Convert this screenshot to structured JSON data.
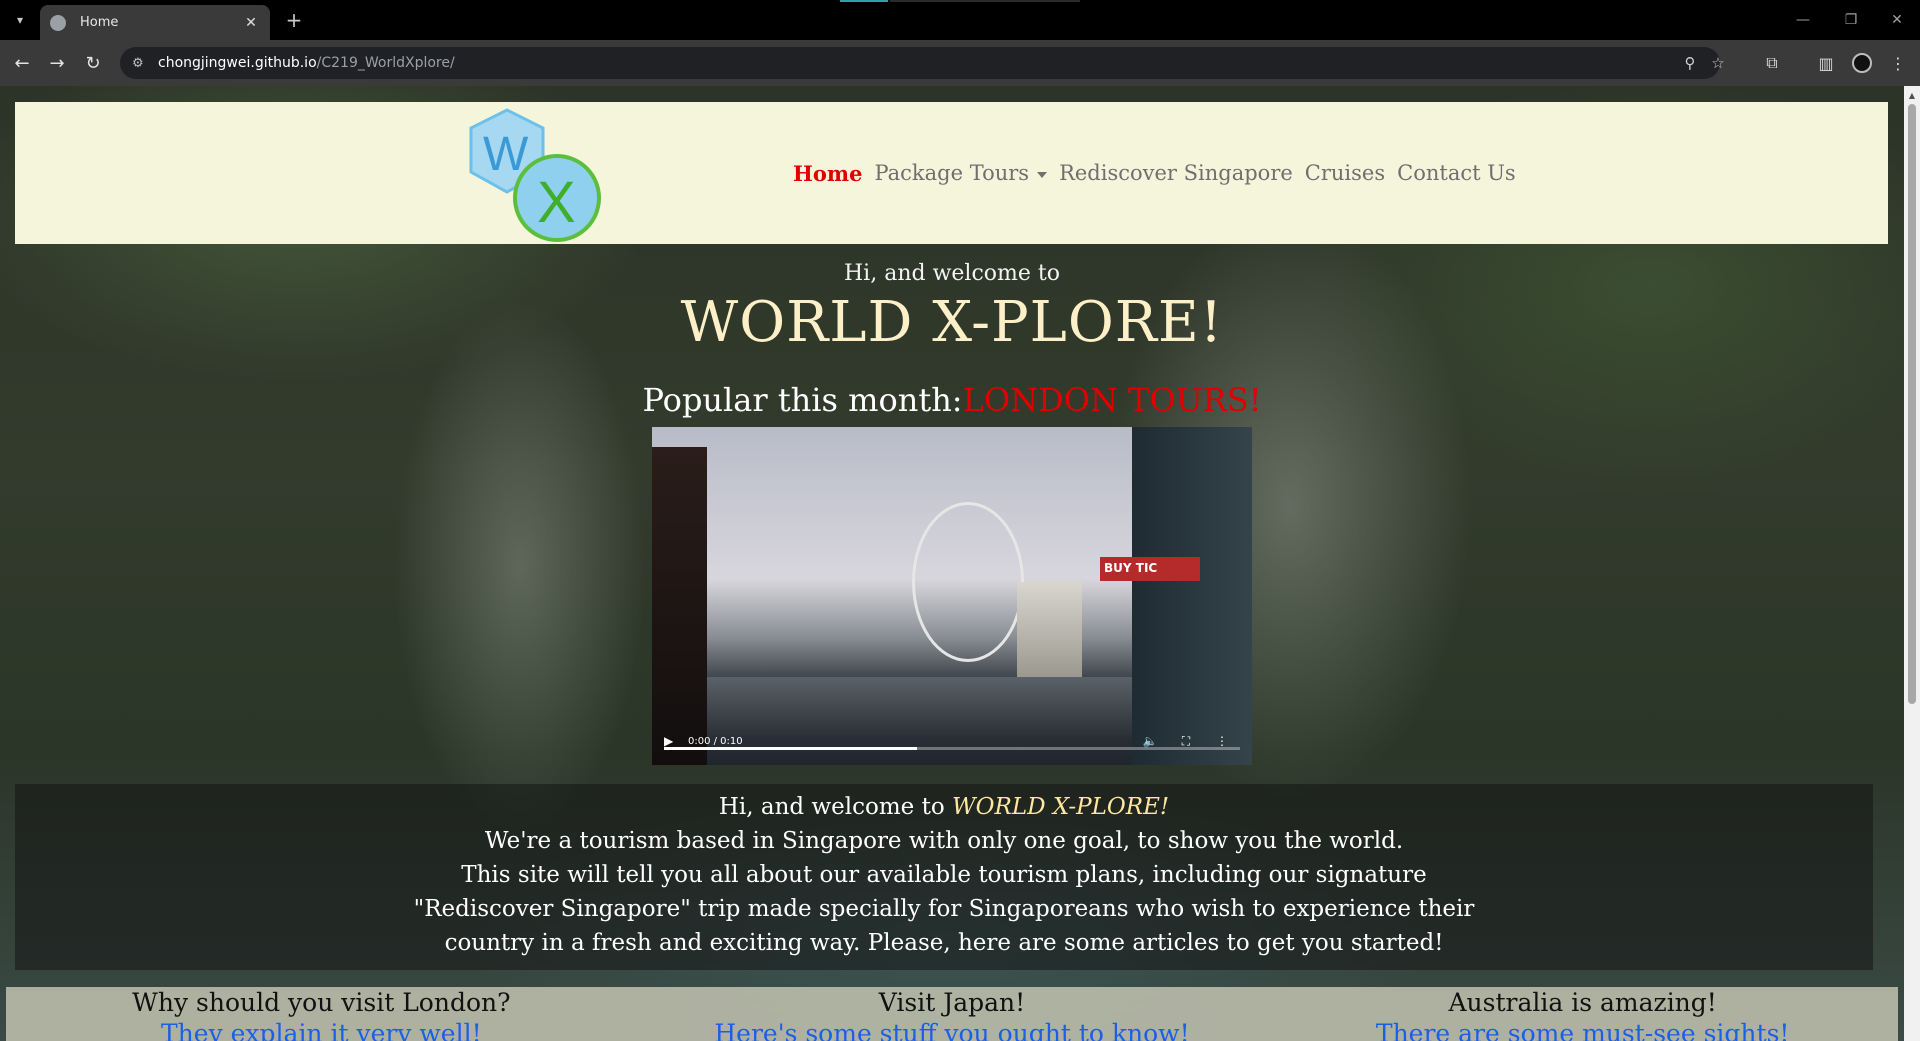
{
  "browser": {
    "tab_title": "Home",
    "tab_close": "✕",
    "new_tab": "+",
    "url_host": "chongjingwei.github.io",
    "url_path": "/C219_WorldXplore/"
  },
  "navbar": {
    "logo_alt": "WX",
    "items": [
      {
        "label": "Home",
        "active": true
      },
      {
        "label": "Package Tours",
        "dropdown": true
      },
      {
        "label": "Rediscover Singapore"
      },
      {
        "label": "Cruises"
      },
      {
        "label": "Contact Us"
      }
    ]
  },
  "hero": {
    "greeting": "Hi, and welcome to",
    "title": "WORLD X-PLORE!",
    "popular_prefix": "Popular this month:",
    "popular_highlight": "LONDON TOURS!"
  },
  "video": {
    "time": "0:00 / 0:10",
    "sign_text": "BUY TIC",
    "progress": 0.44
  },
  "intro": {
    "prefix": "Hi, and welcome to ",
    "brand": "WORLD X-PLORE!",
    "line2": "We're a tourism based in Singapore with only one goal, to show you the world.",
    "line3": "This site will tell you all about our available tourism plans, including our signature",
    "line4": "\"Rediscover Singapore\" trip made specially for Singaporeans who wish to experience their",
    "line5": "country in a fresh and exciting way. Please, here are some articles to get you started!"
  },
  "articles": [
    {
      "title": "Why should you visit London?",
      "link": "They explain it very well!"
    },
    {
      "title": "Visit Japan!",
      "link": "Here's some stuff you ought to know!"
    },
    {
      "title": "Australia is amazing!",
      "link": "There are some must-see sights!"
    }
  ],
  "colors": {
    "navbar_bg": "#f5f5dc",
    "active_link": "#e00000",
    "title_cream": "#fdf0c8",
    "link_blue": "#1a5fe8"
  }
}
